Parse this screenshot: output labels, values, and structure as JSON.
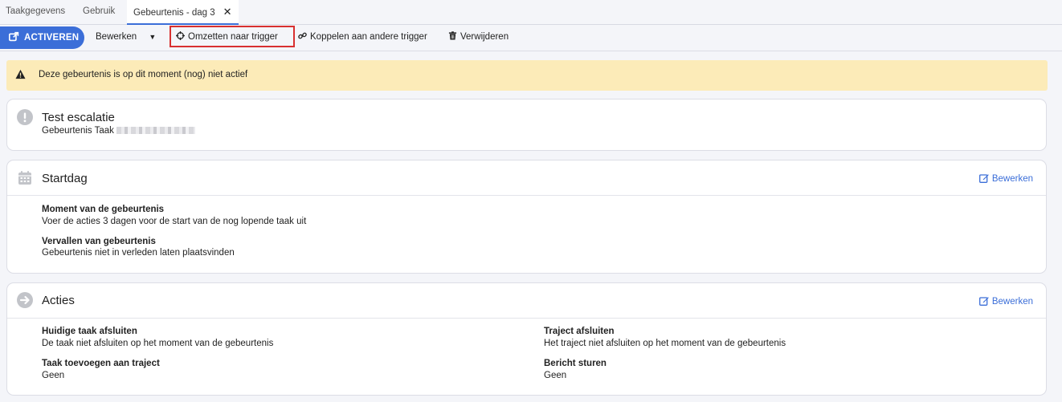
{
  "tabs": [
    {
      "label": "Taakgegevens",
      "active": false
    },
    {
      "label": "Gebruik",
      "active": false
    },
    {
      "label": "Gebeurtenis - dag 3",
      "active": true
    }
  ],
  "toolbar": {
    "activate_label": "ACTIVEREN",
    "edit_label": "Bewerken",
    "convert_label": "Omzetten naar trigger",
    "link_label": "Koppelen aan andere trigger",
    "delete_label": "Verwijderen"
  },
  "warning": {
    "text": "Deze gebeurtenis is op dit moment (nog) niet actief"
  },
  "summary": {
    "title": "Test escalatie",
    "subtitle_prefix": "Gebeurtenis Taak"
  },
  "startdag": {
    "title": "Startdag",
    "edit_label": "Bewerken",
    "fields": [
      {
        "label": "Moment van de gebeurtenis",
        "value": "Voer de acties 3 dagen voor de start van de nog lopende taak uit"
      },
      {
        "label": "Vervallen van gebeurtenis",
        "value": "Gebeurtenis niet in verleden laten plaatsvinden"
      }
    ]
  },
  "acties": {
    "title": "Acties",
    "edit_label": "Bewerken",
    "fields": [
      {
        "label": "Huidige taak afsluiten",
        "value": "De taak niet afsluiten op het moment van de gebeurtenis"
      },
      {
        "label": "Traject afsluiten",
        "value": "Het traject niet afsluiten op het moment van de gebeurtenis"
      },
      {
        "label": "Taak toevoegen aan traject",
        "value": "Geen"
      },
      {
        "label": "Bericht sturen",
        "value": "Geen"
      }
    ]
  },
  "colors": {
    "accent": "#3b6ed8",
    "warning_bg": "#fcebb8",
    "highlight": "#d83030"
  }
}
